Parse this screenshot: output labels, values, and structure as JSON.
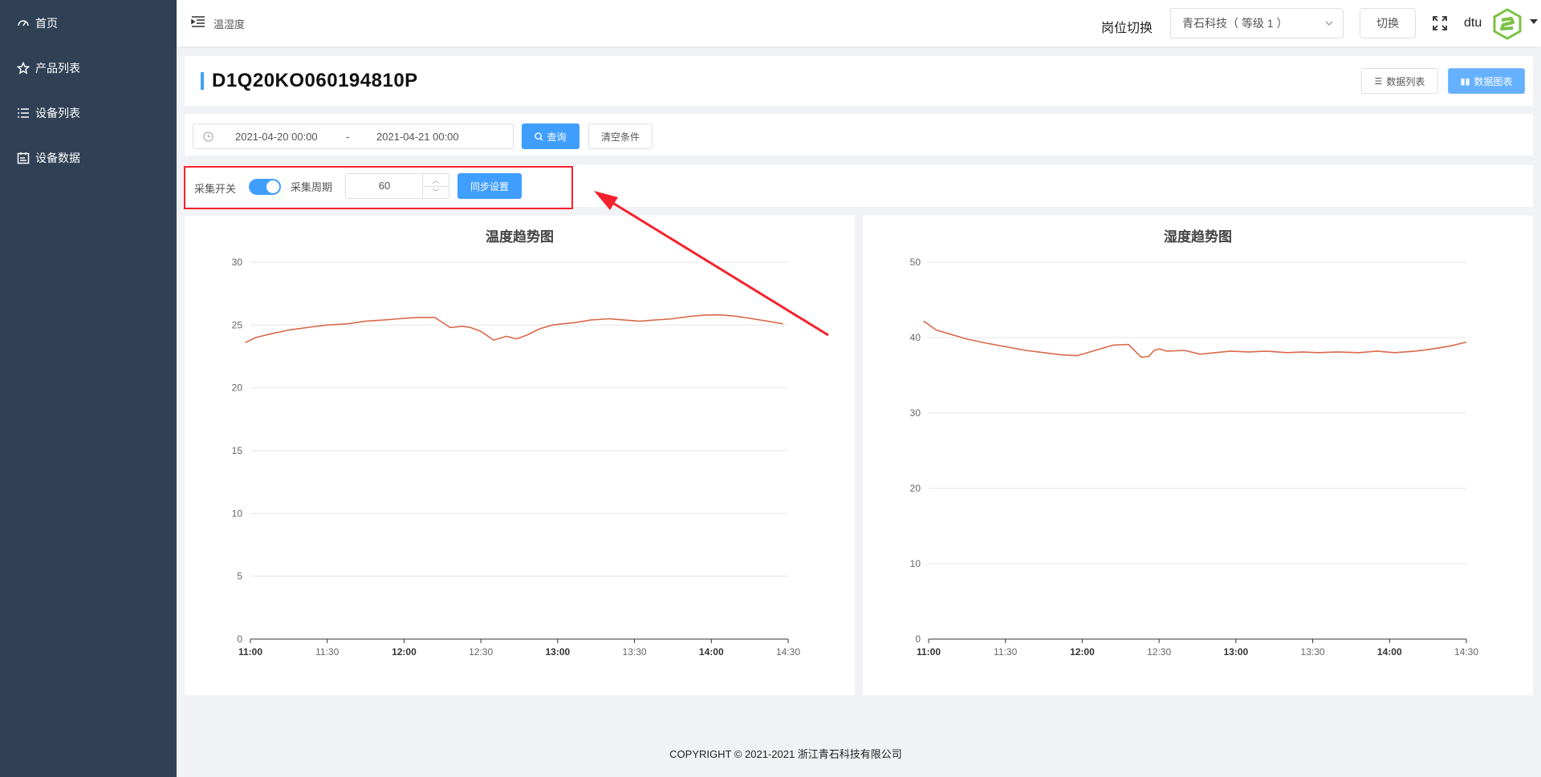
{
  "sidebar": {
    "items": [
      {
        "label": "首页",
        "icon": "dashboard-icon"
      },
      {
        "label": "产品列表",
        "icon": "product-icon"
      },
      {
        "label": "设备列表",
        "icon": "list-icon"
      },
      {
        "label": "设备数据",
        "icon": "data-icon"
      }
    ]
  },
  "header": {
    "breadcrumb": "温湿度",
    "role_label": "岗位切换",
    "role_select": "青石科技（ 等级 1 ）",
    "switch_label": "切换",
    "user": "dtu"
  },
  "device": {
    "title": "D1Q20KO060194810P",
    "btn_list": "数据列表",
    "btn_chart": "数据图表"
  },
  "query": {
    "start": "2021-04-20 00:00",
    "separator": "-",
    "end": "2021-04-21 00:00",
    "query_label": "查询",
    "clear_label": "清空条件"
  },
  "collect": {
    "switch_label": "采集开关",
    "switch_on": true,
    "period_label": "采集周期",
    "period_value": "60",
    "sync_label": "同步设置"
  },
  "colors": {
    "accent": "#409eff",
    "sidebar": "#304156",
    "line": "#d9694a",
    "highlight": "#f5222d"
  },
  "chart_data": [
    {
      "type": "line",
      "title": "温度趋势图",
      "x_ticks": [
        "11:00",
        "11:30",
        "12:00",
        "12:30",
        "13:00",
        "13:30",
        "14:00",
        "14:30"
      ],
      "x_bold": [
        "11:00",
        "12:00",
        "13:00",
        "14:00"
      ],
      "xlim": [
        0,
        210
      ],
      "ylim": [
        0,
        30
      ],
      "y_ticks": [
        "0",
        "5",
        "10",
        "15",
        "20",
        "25",
        "30"
      ],
      "series": [
        {
          "x": [
            -2,
            2,
            8,
            15,
            22,
            30,
            38,
            45,
            52,
            58,
            65,
            72,
            78,
            83,
            86,
            90,
            95,
            100,
            104,
            108,
            113,
            118,
            122,
            127,
            133,
            140,
            146,
            152,
            158,
            165,
            172,
            178,
            184,
            190,
            196,
            202,
            208
          ],
          "y": [
            23.6,
            24.0,
            24.3,
            24.6,
            24.8,
            25.0,
            25.1,
            25.3,
            25.4,
            25.5,
            25.6,
            25.6,
            24.8,
            24.9,
            24.8,
            24.5,
            23.8,
            24.1,
            23.9,
            24.2,
            24.7,
            25.0,
            25.1,
            25.2,
            25.4,
            25.5,
            25.4,
            25.3,
            25.4,
            25.5,
            25.7,
            25.8,
            25.8,
            25.7,
            25.5,
            25.3,
            25.1
          ]
        }
      ]
    },
    {
      "type": "line",
      "title": "湿度趋势图",
      "x_ticks": [
        "11:00",
        "11:30",
        "12:00",
        "12:30",
        "13:00",
        "13:30",
        "14:00",
        "14:30"
      ],
      "x_bold": [
        "11:00",
        "12:00",
        "13:00",
        "14:00"
      ],
      "xlim": [
        0,
        210
      ],
      "ylim": [
        0,
        50
      ],
      "y_ticks": [
        "0",
        "10",
        "20",
        "30",
        "40",
        "50"
      ],
      "series": [
        {
          "x": [
            -2,
            3,
            8,
            15,
            22,
            30,
            38,
            45,
            52,
            58,
            65,
            72,
            78,
            83,
            86,
            88,
            90,
            93,
            100,
            106,
            112,
            118,
            125,
            132,
            140,
            146,
            152,
            160,
            168,
            175,
            182,
            190,
            197,
            204,
            210
          ],
          "y": [
            42.2,
            41.0,
            40.5,
            39.8,
            39.3,
            38.8,
            38.3,
            38.0,
            37.7,
            37.6,
            38.3,
            39.0,
            39.1,
            37.4,
            37.5,
            38.3,
            38.5,
            38.2,
            38.3,
            37.8,
            38.0,
            38.2,
            38.1,
            38.2,
            38.0,
            38.1,
            38.0,
            38.1,
            38.0,
            38.2,
            38.0,
            38.2,
            38.5,
            38.9,
            39.4
          ]
        }
      ]
    }
  ],
  "footer": "COPYRIGHT © 2021-2021 浙江青石科技有限公司"
}
